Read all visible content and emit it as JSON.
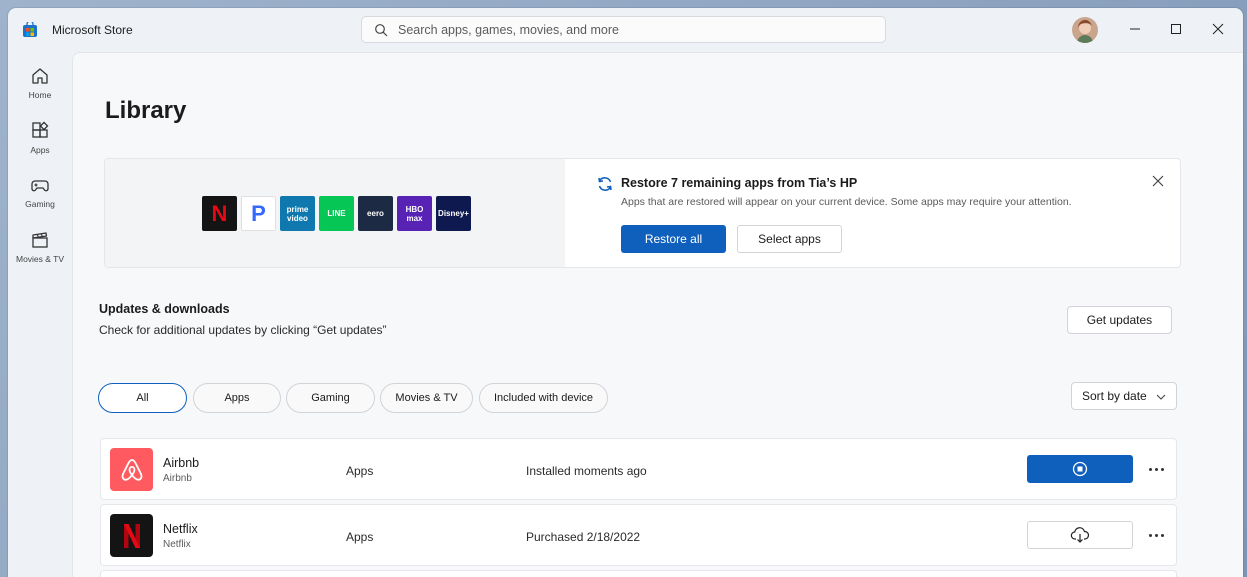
{
  "titlebar": {
    "app_title": "Microsoft Store",
    "search_placeholder": "Search apps, games, movies, and more"
  },
  "sidebar": {
    "items": [
      {
        "label": "Home",
        "icon": "home-icon"
      },
      {
        "label": "Apps",
        "icon": "apps-icon"
      },
      {
        "label": "Gaming",
        "icon": "gamepad-icon"
      },
      {
        "label": "Movies & TV",
        "icon": "clapperboard-icon"
      }
    ]
  },
  "page": {
    "title": "Library"
  },
  "restore": {
    "tiles": [
      {
        "name": "netflix",
        "text": "N",
        "bg": "#141414",
        "fg": "#e50914"
      },
      {
        "name": "pandora",
        "text": "P",
        "bg": "#ffffff",
        "fg": "#3668ff"
      },
      {
        "name": "prime-video",
        "text": "prime video",
        "bg": "#0f79af",
        "fg": "#ffffff"
      },
      {
        "name": "line",
        "text": "LINE",
        "bg": "#06c755",
        "fg": "#ffffff"
      },
      {
        "name": "eero",
        "text": "eero",
        "bg": "#1d2a44",
        "fg": "#ffffff"
      },
      {
        "name": "hbo-max",
        "text": "HBO max",
        "bg": "#5822b4",
        "fg": "#ffffff"
      },
      {
        "name": "disney-plus",
        "text": "Disney+",
        "bg": "#0e1a4f",
        "fg": "#ffffff"
      }
    ],
    "title": "Restore 7 remaining apps from Tia’s HP",
    "description": "Apps that are restored will appear on your current device. Some apps may require your attention.",
    "restore_all_label": "Restore all",
    "select_apps_label": "Select apps"
  },
  "updates": {
    "title": "Updates & downloads",
    "description": "Check for additional updates by clicking “Get updates”",
    "get_updates_label": "Get updates"
  },
  "filters": {
    "chips": [
      "All",
      "Apps",
      "Gaming",
      "Movies & TV",
      "Included with device"
    ],
    "active": "All",
    "sort_label": "Sort by date"
  },
  "rows": [
    {
      "name": "Airbnb",
      "publisher": "Airbnb",
      "category": "Apps",
      "status": "Installed moments ago",
      "icon": "airbnb-logo-icon",
      "action_icon": "stop-icon"
    },
    {
      "name": "Netflix",
      "publisher": "Netflix",
      "category": "Apps",
      "status": "Purchased 2/18/2022",
      "icon": "netflix-logo-icon",
      "action_icon": "cloud-download-icon"
    }
  ],
  "colors": {
    "accent": "#0f5fbd",
    "airbnb": "#ff5a5f",
    "netflix_red": "#e50914"
  }
}
